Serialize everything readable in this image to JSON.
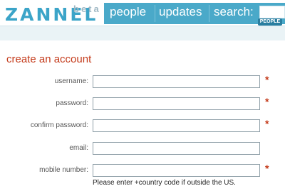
{
  "header": {
    "logo": "ZANNEL",
    "beta": "beta",
    "nav": {
      "people": "people",
      "updates": "updates",
      "search_label": "search:",
      "search_value": "",
      "search_scope": "PEOPLE"
    }
  },
  "form": {
    "title": "create an account",
    "fields": [
      {
        "label": "username:",
        "value": "",
        "required": "*"
      },
      {
        "label": "password:",
        "value": "",
        "required": "*"
      },
      {
        "label": "confirm password:",
        "value": "",
        "required": "*"
      },
      {
        "label": "email:",
        "value": "",
        "required": ""
      },
      {
        "label": "mobile number:",
        "value": "",
        "required": "*"
      }
    ],
    "mobile_hint": "Please enter +country code if outside the US."
  },
  "colors": {
    "brand": "#3ba4c8",
    "nav_bg": "#4aa9c9",
    "accent_red": "#c43a1a"
  }
}
